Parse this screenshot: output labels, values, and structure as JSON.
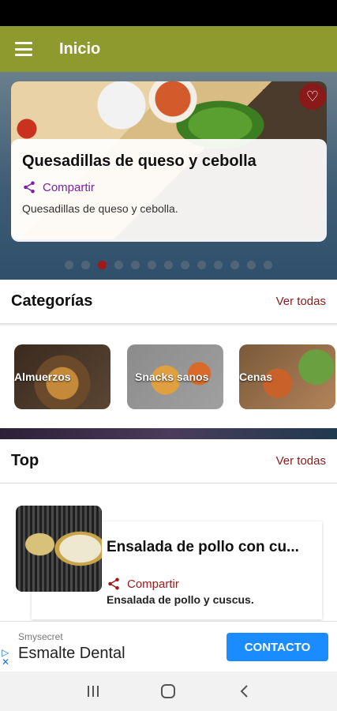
{
  "app": {
    "title": "Inicio"
  },
  "hero": {
    "title": "Quesadillas de queso y cebolla",
    "share_label": "Compartir",
    "description": "Quesadillas de queso y cebolla.",
    "dots_total": 13,
    "active_dot": 3
  },
  "categories": {
    "title": "Categorías",
    "see_all": "Ver todas",
    "items": [
      {
        "label": "Almuerzos"
      },
      {
        "label": "Snacks sanos"
      },
      {
        "label": "Cenas"
      }
    ]
  },
  "top": {
    "title": "Top",
    "see_all": "Ver todas",
    "items": [
      {
        "title": "Ensalada de pollo con cu...",
        "share_label": "Compartir",
        "description": "Ensalada de pollo y cuscus."
      }
    ]
  },
  "ad": {
    "source": "Smysecret",
    "title": "Esmalte Dental",
    "button": "CONTACTO"
  },
  "colors": {
    "appbar": "#8e9a2e",
    "accent": "#a01818",
    "share_purple": "#7b1fa2",
    "ad_button": "#1a8cff"
  },
  "icons": [
    "menu-icon",
    "heart-icon",
    "share-icon",
    "ad-choices-icon",
    "recents-icon",
    "home-icon",
    "back-icon"
  ]
}
